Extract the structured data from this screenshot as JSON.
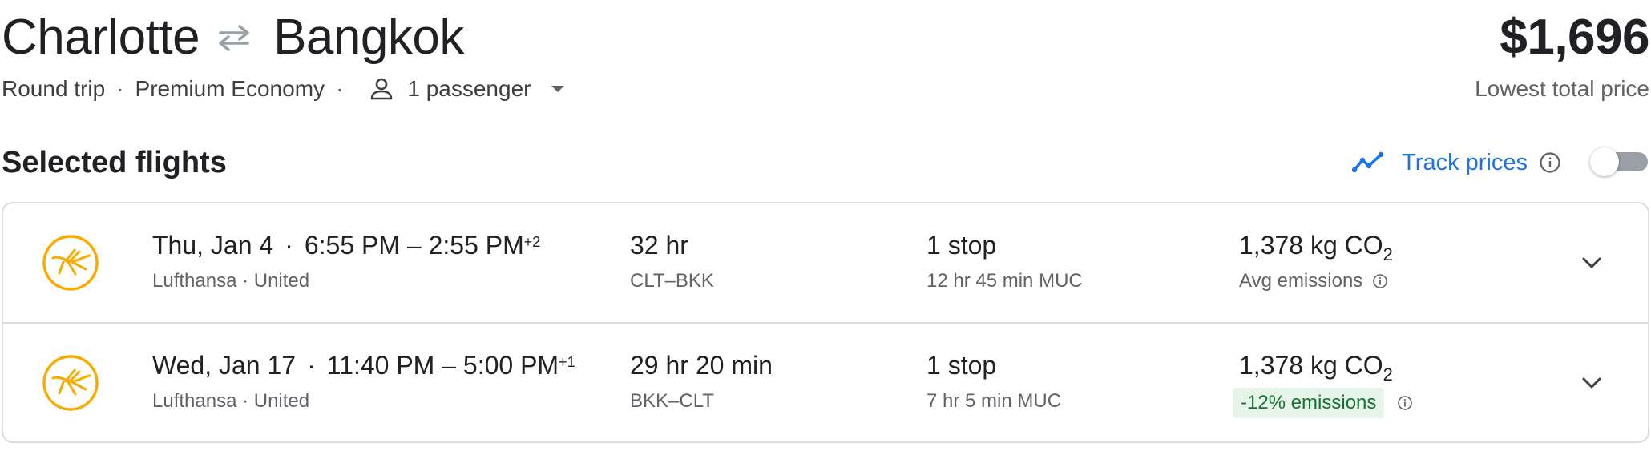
{
  "header": {
    "origin": "Charlotte",
    "destination": "Bangkok",
    "trip_type": "Round trip",
    "separator": "·",
    "cabin": "Premium Economy",
    "passengers": "1 passenger",
    "price": "$1,696",
    "price_label": "Lowest total price"
  },
  "section": {
    "title": "Selected flights",
    "track_prices_label": "Track prices",
    "track_prices_enabled": false
  },
  "flights": [
    {
      "date": "Thu, Jan 4",
      "sep": "·",
      "time_range": "6:55 PM – 2:55 PM",
      "day_offset": "+2",
      "airlines": "Lufthansa · United",
      "duration": "32 hr",
      "route": "CLT–BKK",
      "stops": "1 stop",
      "layover": "12 hr 45 min MUC",
      "co2_value": "1,378 kg CO",
      "co2_sub": "2",
      "emissions_label": "Avg emissions"
    },
    {
      "date": "Wed, Jan 17",
      "sep": "·",
      "time_range": "11:40 PM – 5:00 PM",
      "day_offset": "+1",
      "airlines": "Lufthansa · United",
      "duration": "29 hr 20 min",
      "route": "BKK–CLT",
      "stops": "1 stop",
      "layover": "7 hr 5 min MUC",
      "co2_value": "1,378 kg CO",
      "co2_sub": "2",
      "emissions_label": "-12% emissions"
    }
  ],
  "icons": {
    "swap": "swap-arrows-icon",
    "person": "person-icon",
    "dropdown": "caret-down-icon",
    "trend": "trend-line-icon",
    "info": "info-icon",
    "airline_logo": "lufthansa-logo",
    "expand": "chevron-down-icon"
  },
  "colors": {
    "accent_blue": "#1a73e8",
    "logo_yellow": "#f9ab00",
    "emissions_green_bg": "#e6f4ea",
    "emissions_green_text": "#137333",
    "border": "#dadce0"
  }
}
